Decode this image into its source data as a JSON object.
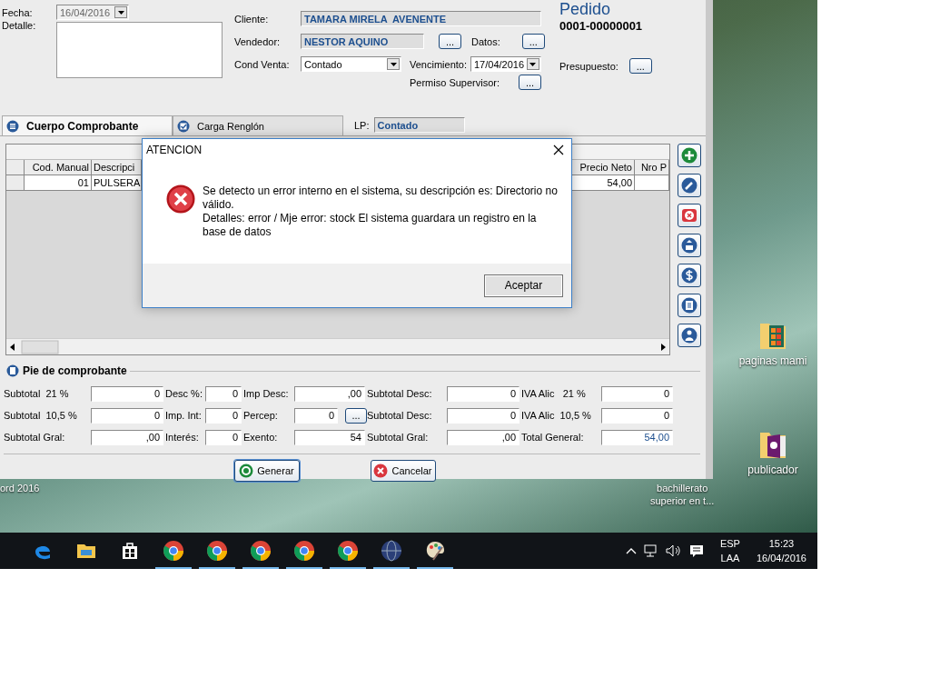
{
  "window": {
    "doc_type": "Pedido",
    "doc_number": "0001-00000001",
    "header": {
      "fecha": {
        "label": "Fecha:",
        "value": "16/04/2016",
        "disabled": true
      },
      "detalle": {
        "label": "Detalle:"
      },
      "cliente": {
        "label": "Cliente:",
        "value": "TAMARA MIRELA  AVENENTE"
      },
      "vendedor": {
        "label": "Vendedor:",
        "value": "NESTOR AQUINO",
        "button": "..."
      },
      "datos": {
        "label": "Datos:",
        "button": "..."
      },
      "cond_venta": {
        "label": "Cond Venta:",
        "value": "Contado"
      },
      "vencimiento": {
        "label": "Vencimiento:",
        "value": "17/04/2016"
      },
      "permiso_supervisor": {
        "label": "Permiso Supervisor:",
        "button": "..."
      },
      "presupuesto": {
        "label": "Presupuesto:",
        "button": "..."
      }
    },
    "tabs": [
      {
        "label": "Cuerpo Comprobante",
        "selected": true,
        "kind": "list"
      },
      {
        "label": "Carga Renglón",
        "selected": false,
        "kind": "check"
      }
    ],
    "lp": {
      "label": "LP:",
      "value": "Contado"
    },
    "table": {
      "columns": [
        "Cod. Manual",
        "Descripci",
        "Precio Neto",
        "Nro P"
      ],
      "rows": [
        [
          "01",
          "PULSERA",
          "54,00"
        ]
      ]
    },
    "side_buttons": [
      {
        "kind": "add"
      },
      {
        "kind": "edit"
      },
      {
        "kind": "delete"
      },
      {
        "kind": "upload"
      },
      {
        "kind": "money"
      },
      {
        "kind": "document"
      },
      {
        "kind": "person"
      }
    ],
    "footer": {
      "title": "Pie de comprobante",
      "rows": [
        [
          {
            "label": "Subtotal  21 %",
            "value": "0",
            "emphasis": false
          },
          {
            "label": "Desc %:",
            "value": "0",
            "emphasis": false
          },
          {
            "label": "Imp Desc:",
            "value": ",00",
            "emphasis": false
          },
          {
            "label": "Subtotal Desc:",
            "value": "0",
            "emphasis": false
          },
          {
            "label": "IVA Alic   21 %",
            "value": "0",
            "emphasis": false
          }
        ],
        [
          {
            "label": "Subtotal  10,5 %",
            "value": "0",
            "emphasis": false
          },
          {
            "label": "Imp. Int:",
            "value": "0",
            "emphasis": false
          },
          {
            "label": "Percep:",
            "value": "0",
            "button": "...",
            "emphasis": false
          },
          {
            "label": "Subtotal Desc:",
            "value": "0",
            "emphasis": false
          },
          {
            "label": "IVA Alic  10,5 %",
            "value": "0",
            "emphasis": false
          }
        ],
        [
          {
            "label": "Subtotal Gral:",
            "value": ",00",
            "emphasis": false
          },
          {
            "label": "Interés:",
            "value": "0",
            "emphasis": false
          },
          {
            "label": "Exento:",
            "value": "54",
            "emphasis": false
          },
          {
            "label": "Subtotal Gral:",
            "value": ",00",
            "emphasis": false
          },
          {
            "label": "Total General:",
            "value": "54,00",
            "emphasis": true
          }
        ]
      ]
    },
    "actions": [
      {
        "label": "Generar",
        "kind": "generate"
      },
      {
        "label": "Cancelar",
        "kind": "cancel"
      }
    ]
  },
  "dialog": {
    "title": "ATENCION",
    "kind": "error",
    "message": [
      "Se detecto un error interno en el sistema, su descripción es: Directorio no válido.",
      "Detalles: error / Mje error: stock El sistema guardara un registro en la base de datos"
    ],
    "button": "Aceptar"
  },
  "desktop": {
    "icons": [
      {
        "label": "paginas mami",
        "kind": "pages"
      },
      {
        "label": "publicador",
        "kind": "publisher"
      }
    ],
    "partial_labels": [
      {
        "lines": [
          "ord 2016"
        ]
      },
      {
        "lines": [
          "bachillerato",
          "superior en t..."
        ]
      }
    ]
  },
  "taskbar": {
    "apps": [
      {
        "kind": "edge",
        "running": false
      },
      {
        "kind": "explorer",
        "running": false
      },
      {
        "kind": "store",
        "running": false
      },
      {
        "kind": "chrome",
        "running": true
      },
      {
        "kind": "chrome",
        "running": true
      },
      {
        "kind": "chrome",
        "running": true
      },
      {
        "kind": "chrome",
        "running": true
      },
      {
        "kind": "chrome",
        "running": true
      },
      {
        "kind": "globe",
        "running": true
      },
      {
        "kind": "paint",
        "running": true
      }
    ],
    "language": [
      "ESP",
      "LAA"
    ],
    "time": "15:23",
    "date": "16/04/2016"
  }
}
